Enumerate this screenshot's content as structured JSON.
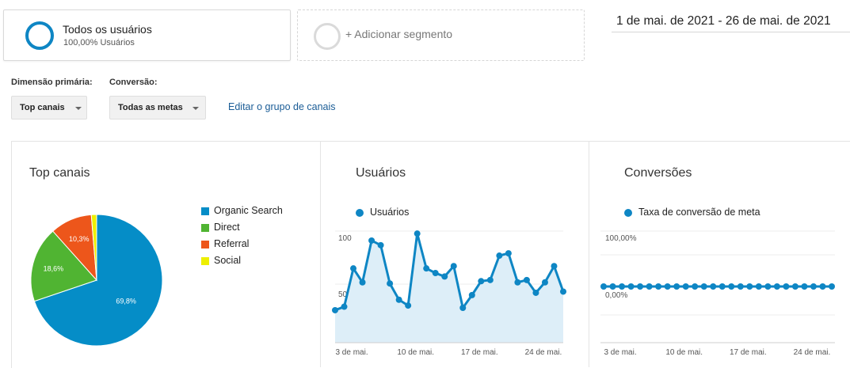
{
  "segments": {
    "active": {
      "title": "Todos os usuários",
      "subtitle": "100,00% Usuários"
    },
    "add_label": "+ Adicionar segmento"
  },
  "date_range": "1 de mai. de 2021 - 26 de mai. de 2021",
  "controls": {
    "primary_dimension_label": "Dimensão primária:",
    "primary_dimension_value": "Top canais",
    "conversion_label": "Conversão:",
    "conversion_value": "Todas as metas",
    "edit_link": "Editar o grupo de canais"
  },
  "colors": {
    "accent": "#0e86c4",
    "organic": "#058dc7",
    "direct": "#50b432",
    "referral": "#ed561b",
    "social": "#edef00",
    "area_fill": "#ddeef8"
  },
  "pie_panel": {
    "title": "Top canais"
  },
  "users_panel": {
    "title": "Usuários",
    "legend": "Usuários"
  },
  "conversions_panel": {
    "title": "Conversões",
    "legend": "Taxa de conversão de meta"
  },
  "chart_data": [
    {
      "type": "pie",
      "title": "Top canais",
      "categories": [
        "Organic Search",
        "Direct",
        "Referral",
        "Social"
      ],
      "values": [
        69.8,
        18.6,
        10.3,
        1.3
      ],
      "labels": [
        "69,8%",
        "18,6%",
        "10,3%",
        ""
      ]
    },
    {
      "type": "area",
      "title": "Usuários",
      "series": [
        {
          "name": "Usuários",
          "values": [
            28,
            31,
            64,
            52,
            88,
            84,
            51,
            37,
            32,
            94,
            64,
            60,
            57,
            66,
            30,
            41,
            53,
            54,
            75,
            77,
            52,
            54,
            43,
            52,
            66,
            44
          ]
        }
      ],
      "x": [
        "1",
        "2",
        "3",
        "4",
        "5",
        "6",
        "7",
        "8",
        "9",
        "10",
        "11",
        "12",
        "13",
        "14",
        "15",
        "16",
        "17",
        "18",
        "19",
        "20",
        "21",
        "22",
        "23",
        "24",
        "25",
        "26"
      ],
      "x_tick_labels": [
        "3 de mai.",
        "10 de mai.",
        "17 de mai.",
        "24 de mai."
      ],
      "y_tick_labels": [
        "100",
        "50"
      ],
      "ylim": [
        0,
        100
      ],
      "grid": true
    },
    {
      "type": "line",
      "title": "Conversões",
      "series": [
        {
          "name": "Taxa de conversão de meta",
          "values": [
            0,
            0,
            0,
            0,
            0,
            0,
            0,
            0,
            0,
            0,
            0,
            0,
            0,
            0,
            0,
            0,
            0,
            0,
            0,
            0,
            0,
            0,
            0,
            0,
            0,
            0
          ]
        }
      ],
      "x_tick_labels": [
        "3 de mai.",
        "10 de mai.",
        "17 de mai.",
        "24 de mai."
      ],
      "y_tick_labels": [
        "100,00%",
        "0,00%"
      ],
      "grid": true
    }
  ]
}
